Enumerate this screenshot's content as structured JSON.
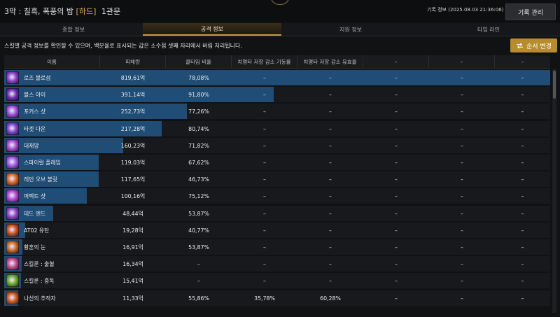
{
  "window": {
    "title_prefix": "3막 : 칠흑, 폭풍의 밤",
    "difficulty": "[하드]",
    "gate": "1관문",
    "record_info": "기록 정보 (2025.08.03 21:36:06)",
    "record_button": "기록 관리"
  },
  "tabs": [
    {
      "label": "종합 정보"
    },
    {
      "label": "공격 정보"
    },
    {
      "label": "지원 정보"
    },
    {
      "label": "타임 라인"
    }
  ],
  "active_tab": 1,
  "description": "스킬별 공격 정보를 확인할 수 있으며, 백분율로 표시되는 값은 소수점 셋째 자리에서 버림 처리됩니다.",
  "order_button": "순서 변경",
  "columns": [
    "이름",
    "피해량",
    "쿨타임 비율",
    "치명타 저항 감소 기동률",
    "치명타 저항 감소 유효율",
    "–",
    "–",
    "–",
    "–"
  ],
  "skills": [
    {
      "name": "로즈 블로섬",
      "damage": "819,61억",
      "cooldown": "78,08%",
      "crit_uptime": "–",
      "crit_effective": "–",
      "bar": 1.0,
      "icon_color": "#8a3fc4"
    },
    {
      "name": "블스 아이",
      "damage": "391,14억",
      "cooldown": "91,80%",
      "crit_uptime": "–",
      "crit_effective": "–",
      "bar": 0.4935,
      "icon_color": "#6a2fb0"
    },
    {
      "name": "포커스 샷",
      "damage": "252,73억",
      "cooldown": "77,26%",
      "crit_uptime": "–",
      "crit_effective": "–",
      "bar": 0.3346,
      "icon_color": "#9b4fd8"
    },
    {
      "name": "타겟 다운",
      "damage": "217,28억",
      "cooldown": "80,74%",
      "crit_uptime": "–",
      "crit_effective": "–",
      "bar": 0.2885,
      "icon_color": "#7a45c8"
    },
    {
      "name": "대재앙",
      "damage": "160,23억",
      "cooldown": "71,82%",
      "crit_uptime": "–",
      "crit_effective": "–",
      "bar": 0.2179,
      "icon_color": "#a24cc9"
    },
    {
      "name": "스파이럴 플레임",
      "damage": "119,03억",
      "cooldown": "67,62%",
      "crit_uptime": "–",
      "crit_effective": "–",
      "bar": 0.1731,
      "icon_color": "#9a5be0"
    },
    {
      "name": "레인 오브 불릿",
      "damage": "117,65억",
      "cooldown": "46,73%",
      "crit_uptime": "–",
      "crit_effective": "–",
      "bar": 0.1731,
      "icon_color": "#d06a2a"
    },
    {
      "name": "퍼펙트 샷",
      "damage": "100,16억",
      "cooldown": "75,12%",
      "crit_uptime": "–",
      "crit_effective": "–",
      "bar": 0.1513,
      "icon_color": "#b04ad2"
    },
    {
      "name": "데드 엔드",
      "damage": "48,44억",
      "cooldown": "53,87%",
      "crit_uptime": "–",
      "crit_effective": "–",
      "bar": 0.0897,
      "icon_color": "#8848c0"
    },
    {
      "name": "AT02 유탄",
      "damage": "19,28억",
      "cooldown": "40,77%",
      "crit_uptime": "–",
      "crit_effective": "–",
      "bar": 0.0385,
      "icon_color": "#c9501f"
    },
    {
      "name": "황혼의 눈",
      "damage": "16,91억",
      "cooldown": "53,87%",
      "crit_uptime": "–",
      "crit_effective": "–",
      "bar": 0.0333,
      "icon_color": "#c86a28"
    },
    {
      "name": "스킬룬 : 출혈",
      "damage": "16,34억",
      "cooldown": "–",
      "crit_uptime": "–",
      "crit_effective": "–",
      "bar": 0.0321,
      "icon_color": "#c24a8a"
    },
    {
      "name": "스킬룬 : 중독",
      "damage": "15,41억",
      "cooldown": "–",
      "crit_uptime": "–",
      "crit_effective": "–",
      "bar": 0.0308,
      "icon_color": "#6aa82a"
    },
    {
      "name": "나선의 추적자",
      "damage": "11,33억",
      "cooldown": "55,86%",
      "crit_uptime": "35,78%",
      "crit_effective": "60,28%",
      "bar": 0.0256,
      "icon_color": "#c85a22"
    }
  ],
  "dash": "–"
}
